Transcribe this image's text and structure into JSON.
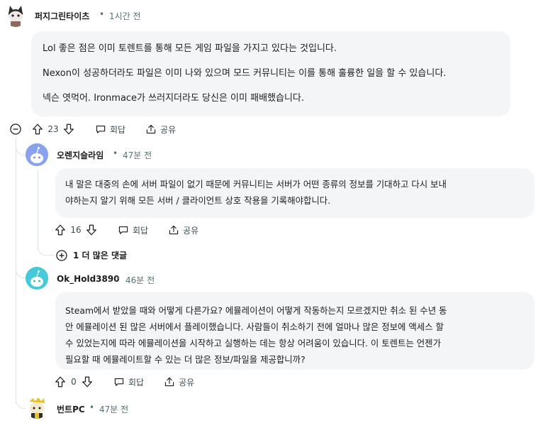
{
  "comments": [
    {
      "author": "퍼지그린타이츠",
      "time": "1시간 전",
      "paragraphs": [
        "Lol 좋은 점은 이미 토렌트를 통해 모든 게임 파일을 가지고 있다는 것입니다.",
        "Nexon이 성공하더라도 파일은 이미 나와 있으며 모드 커뮤니티는 이를 통해 훌륭한 일을 할 수 있습니다.",
        "넥슨 엿먹어. Ironmace가 쓰러지더라도 당신은 이미 패배했습니다."
      ],
      "votes": "23",
      "reply_label": "회답",
      "share_label": "공유"
    },
    {
      "author": "오렌지슬라임",
      "time": "47분 전",
      "lines": [
        "내 말은 대중의 손에 서버 파일이 없기 때문에 커뮤니티는 서버가 어떤 종류의 정보를 기대하고 다시 보내",
        "야하는지 알기 위해 모든 서버 / 클라이언트 상호 작용을 기록해야합니다."
      ],
      "votes": "16",
      "reply_label": "회답",
      "share_label": "공유",
      "more_replies": "1 더 많은 댓글"
    },
    {
      "author": "Ok_Hold3890",
      "time": "46분 전",
      "lines": [
        "Steam에서 받았을 때와 어떻게 다른가요? 에뮬레이션이 어떻게 작동하는지 모르겠지만 취소 된 수년 동",
        "안 에뮬레이션 된 많은 서버에서 플레이했습니다. 사람들이 취소하기 전에 얼마나 많은 정보에 액세스 할",
        "수 있었는지에 따라 에뮬레이션을 시작하고 실행하는 데는 항상 어려움이 있습니다. 이 토렌트는 언젠가",
        "필요할 때 에뮬레이트할 수 있는 더 많은 정보/파일을 제공합니까?"
      ],
      "votes": "0",
      "reply_label": "회답",
      "share_label": "공유"
    },
    {
      "author": "번트PC",
      "time": "47분 전"
    }
  ],
  "colors": {
    "bubble_bg": "#f3f5f7",
    "thread_line": "#dfe4e6",
    "meta_text": "#576f76"
  }
}
